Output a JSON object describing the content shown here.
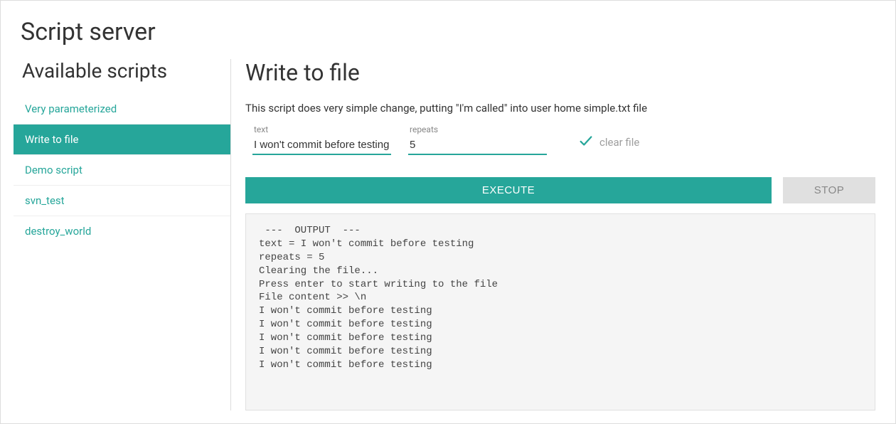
{
  "app_title": "Script server",
  "sidebar": {
    "title": "Available scripts",
    "items": [
      {
        "label": "Very parameterized",
        "active": false
      },
      {
        "label": "Write to file",
        "active": true
      },
      {
        "label": "Demo script",
        "active": false
      },
      {
        "label": "svn_test",
        "active": false
      },
      {
        "label": "destroy_world",
        "active": false
      }
    ]
  },
  "main": {
    "title": "Write to file",
    "description": "This script does very simple change, putting \"I'm called\" into user home simple.txt file",
    "params": {
      "text": {
        "label": "text",
        "value": "I won't commit before testing"
      },
      "repeats": {
        "label": "repeats",
        "value": "5"
      },
      "clear_file": {
        "label": "clear file",
        "checked": true
      }
    },
    "buttons": {
      "execute": "Execute",
      "stop": "Stop"
    },
    "output": " ---  OUTPUT  ---\ntext = I won't commit before testing\nrepeats = 5\nClearing the file...\nPress enter to start writing to the file\nFile content >> \\n\nI won't commit before testing\nI won't commit before testing\nI won't commit before testing\nI won't commit before testing\nI won't commit before testing"
  },
  "colors": {
    "accent": "#26a69a"
  }
}
